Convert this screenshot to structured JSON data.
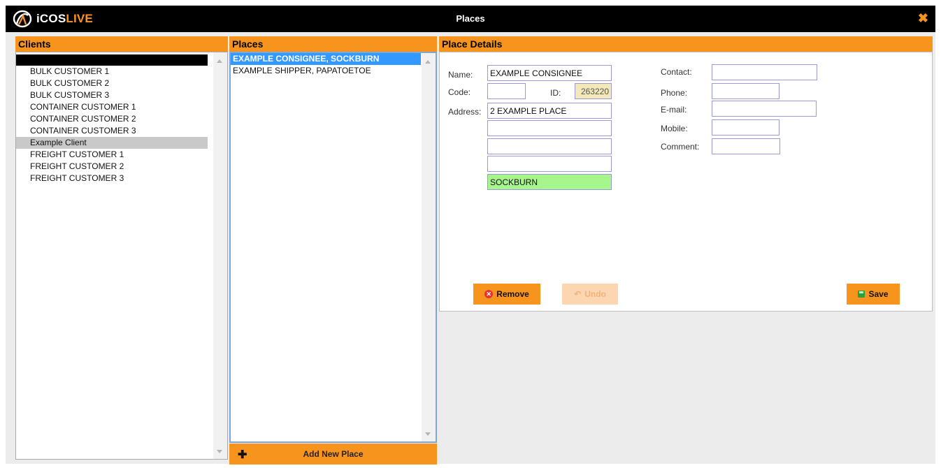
{
  "window": {
    "title": "Places",
    "logo_text_part1": "iCOS",
    "logo_text_part2": "LIVE"
  },
  "clients": {
    "header": "Clients",
    "items": [
      {
        "label": "BULK CUSTOMER 1",
        "selected": false
      },
      {
        "label": "BULK CUSTOMER 2",
        "selected": false
      },
      {
        "label": "BULK CUSTOMER 3",
        "selected": false
      },
      {
        "label": "CONTAINER CUSTOMER 1",
        "selected": false
      },
      {
        "label": "CONTAINER CUSTOMER 2",
        "selected": false
      },
      {
        "label": "CONTAINER CUSTOMER 3",
        "selected": false
      },
      {
        "label": "Example Client",
        "selected": true
      },
      {
        "label": "FREIGHT CUSTOMER 1",
        "selected": false
      },
      {
        "label": "FREIGHT CUSTOMER 2",
        "selected": false
      },
      {
        "label": "FREIGHT CUSTOMER 3",
        "selected": false
      }
    ]
  },
  "places": {
    "header": "Places",
    "items": [
      {
        "label": "EXAMPLE CONSIGNEE, SOCKBURN",
        "selected": true
      },
      {
        "label": "EXAMPLE SHIPPER, PAPATOETOE",
        "selected": false
      }
    ],
    "add_button_label": "Add New Place"
  },
  "details": {
    "header": "Place Details",
    "labels": {
      "name": "Name:",
      "code": "Code:",
      "id": "ID:",
      "address": "Address:",
      "contact": "Contact:",
      "phone": "Phone:",
      "email": "E-mail:",
      "mobile": "Mobile:",
      "comment": "Comment:"
    },
    "values": {
      "name": "EXAMPLE CONSIGNEE",
      "code": "",
      "id": "263220",
      "address1": "2 EXAMPLE PLACE",
      "address2": "",
      "address3": "",
      "address4": "",
      "city": "SOCKBURN",
      "contact": "",
      "phone": "",
      "email": "",
      "mobile": "",
      "comment": ""
    },
    "buttons": {
      "remove": "Remove",
      "undo": "Undo",
      "save": "Save"
    }
  },
  "colors": {
    "accent": "#f7941d",
    "titlebar": "#000000",
    "selection": "#3399ff",
    "city_field": "#a6f58d",
    "id_field": "#f3e8b8"
  }
}
